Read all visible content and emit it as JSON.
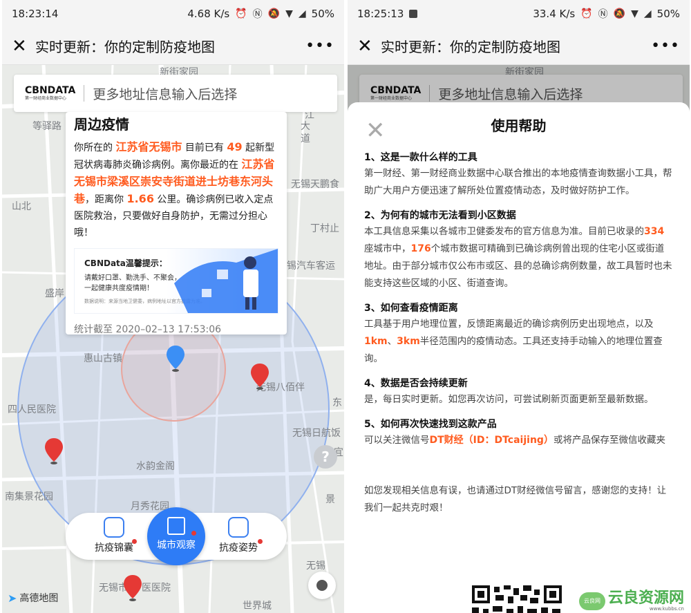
{
  "left": {
    "status": {
      "time": "18:23:14",
      "speed": "4.68 K/s",
      "battery": "50%"
    },
    "title": "实时更新：你的定制防疫地图",
    "search": {
      "logo": "CBNDATA",
      "logo_sub": "第一财经商业数据中心",
      "placeholder": "更多地址信息输入后选择"
    },
    "map_labels": [
      "新街家园",
      "等驿路",
      "江",
      "大",
      "道",
      "无锡天鹏食",
      "山北",
      "丁村止",
      "锡汽车客运",
      "盛岸",
      "惠山古镇",
      "无锡八佰伴",
      "四人民医院",
      "无锡日航饭",
      "东",
      "水韵金阁",
      "南集景花园",
      "月秀花园",
      "景",
      "宜",
      "无锡市",
      "医医院",
      "世界城",
      "无锡"
    ],
    "card": {
      "heading": "周边疫情",
      "p1": "你所在的",
      "city": "江苏省无锡市",
      "p2": "目前已有",
      "count": "49",
      "p3": "起新型冠状病毒肺炎确诊病例。离你最近的在",
      "place": "江苏省无锡市梁溪区崇安寺街道进士坊巷东河头巷",
      "p4": "，距离你",
      "distance": "1.66",
      "p5": "公里。确诊病例已收入定点医院救治，只要做好自身防护，无需过分担心哦！",
      "tip_title": "CBNData温馨提示：",
      "tip_text1": "请戴好口罩、勤洗手、不聚会，",
      "tip_text2": "一起健康共度疫情期！",
      "tip_foot": "数据说明：来源当地卫健委，病例地址以官方披露为准。",
      "stat": "统计截至 2020–02–13 17:53:06"
    },
    "nav": {
      "item1": "抗疫锦囊",
      "center": "城市观察",
      "item3": "抗疫姿势"
    },
    "amap": "高德地图",
    "colors": {
      "accent": "#2e7cf6",
      "highlight": "#ff5b1f",
      "pin_red": "#e53935",
      "pin_blue": "#3b8ff5"
    }
  },
  "right": {
    "status": {
      "time": "18:25:13",
      "speed": "33.4 K/s",
      "battery": "50%"
    },
    "title": "实时更新：你的定制防疫地图",
    "search": {
      "logo": "CBNDATA",
      "logo_sub": "第一财经商业数据中心",
      "placeholder": "更多地址信息输入后选择"
    },
    "map_label": "新街家园",
    "sheet": {
      "title": "使用帮助",
      "q1": "1、这是一款什么样的工具",
      "a1": "第一财经、第一财经商业数据中心联合推出的本地疫情查询数据小工具，帮助广大用户方便迅速了解所处位置疫情动态，及时做好防护工作。",
      "q2": "2、为何有的城市无法看到小区数据",
      "a2a": "本工具信息采集以各城市卫健委发布的官方信息为准。目前已收录的",
      "a2_n1": "334",
      "a2b": "座城市中，",
      "a2_n2": "176",
      "a2c": "个城市数据可精确到已确诊病例曾出现的住宅小区或街道地址。由于部分城市仅公布市或区、县的总确诊病例数量，故工具暂时也未能支持这些区域的小区、街道查询。",
      "q3": "3、如何查看疫情距离",
      "a3a": "工具基于用户地理位置，反馈距离最近的确诊病例历史出现地点，以及",
      "a3_n1": "1km",
      "a3b": "、",
      "a3_n2": "3km",
      "a3c": "半径范围内的疫情动态。工具还支持手动输入的地理位置查询。",
      "q4": "4、数据是否会持续更新",
      "a4": "是，每日实时更新。如您再次访问，可尝试刷新页面更新至最新数据。",
      "q5": "5、如何再次快速找到这款产品",
      "a5a": "可以关注微信号",
      "a5_hl": "DT财经（ID：DTcaijing）",
      "a5b": "或将产品保存至微信收藏夹",
      "foot": "如您发现相关信息有误，也请通过DT财经微信号留言，感谢您的支持！让我们一起共克时艰！"
    },
    "watermark": {
      "text": "云良资源网",
      "cloud": "云良网",
      "url": "www.kubbs.cn"
    }
  }
}
